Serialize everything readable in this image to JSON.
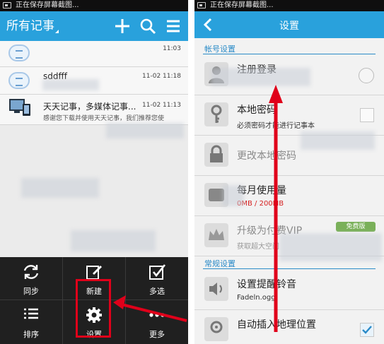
{
  "left": {
    "status_text": "正在保存屏幕截图...",
    "header": {
      "title": "所有记事"
    },
    "notes": [
      {
        "title": "",
        "date": "11:03",
        "subtitle": ""
      },
      {
        "title": "sddfff",
        "date": "11-02 11:18",
        "subtitle": ""
      },
      {
        "title": "天天记事，多媒体记事...",
        "date": "11-02 11:13",
        "subtitle": "感谢您下载并使用天天记事，我们推荐您使"
      }
    ],
    "menu": [
      {
        "label": "同步",
        "icon": "sync-icon"
      },
      {
        "label": "新建",
        "icon": "new-note-icon"
      },
      {
        "label": "多选",
        "icon": "multi-select-icon"
      },
      {
        "label": "排序",
        "icon": "sort-icon"
      },
      {
        "label": "设置",
        "icon": "gear-icon"
      },
      {
        "label": "更多",
        "icon": "more-icon"
      }
    ]
  },
  "right": {
    "status_text": "正在保存屏幕截图...",
    "header": {
      "title": "设置"
    },
    "account_section": "帐号设置",
    "general_section": "常规设置",
    "rows": [
      {
        "title": "注册登录",
        "subtitle": ""
      },
      {
        "title": "本地密码",
        "subtitle": "必须密码才能进行记事本"
      },
      {
        "title": "更改本地密码",
        "subtitle": ""
      },
      {
        "title": "每月使用量",
        "subtitle": "0MB / 200MB"
      },
      {
        "title": "升级为付费VIP",
        "subtitle": "获取超大空间",
        "badge": "免费版"
      },
      {
        "title": "设置提醒铃音",
        "subtitle": "Fadeln.ogg"
      },
      {
        "title": "自动插入地理位置",
        "subtitle": ""
      }
    ]
  },
  "colors": {
    "accent": "#29a1dc",
    "menu_bg": "#202020",
    "highlight": "#e0001a"
  }
}
